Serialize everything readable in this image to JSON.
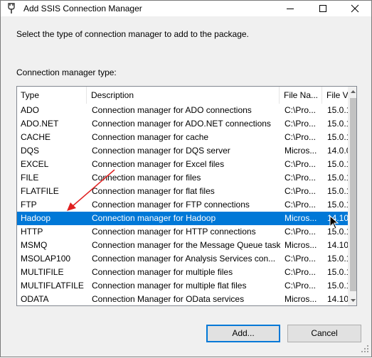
{
  "window": {
    "title": "Add SSIS Connection Manager",
    "controls": [
      "minimize-icon",
      "maximize-icon",
      "close-icon"
    ]
  },
  "dialog": {
    "instruction": "Select the type of connection manager to add to the package.",
    "list_label": "Connection manager type:"
  },
  "table": {
    "headers": {
      "type": "Type",
      "description": "Description",
      "file_name": "File Na...",
      "file_version": "File V"
    },
    "rows": [
      {
        "type": "ADO",
        "description": "Connection manager for ADO connections",
        "file_name": "C:\\Pro...",
        "file_version": "15.0.1"
      },
      {
        "type": "ADO.NET",
        "description": "Connection manager for ADO.NET connections",
        "file_name": "C:\\Pro...",
        "file_version": "15.0.1"
      },
      {
        "type": "CACHE",
        "description": "Connection manager for cache",
        "file_name": "C:\\Pro...",
        "file_version": "15.0.1"
      },
      {
        "type": "DQS",
        "description": "Connection manager for DQS server",
        "file_name": "Micros...",
        "file_version": "14.0.0"
      },
      {
        "type": "EXCEL",
        "description": "Connection manager for Excel files",
        "file_name": "C:\\Pro...",
        "file_version": "15.0.1"
      },
      {
        "type": "FILE",
        "description": "Connection manager for files",
        "file_name": "C:\\Pro...",
        "file_version": "15.0.1"
      },
      {
        "type": "FLATFILE",
        "description": "Connection manager for flat files",
        "file_name": "C:\\Pro...",
        "file_version": "15.0.1"
      },
      {
        "type": "FTP",
        "description": "Connection manager for FTP connections",
        "file_name": "C:\\Pro...",
        "file_version": "15.0.1"
      },
      {
        "type": "Hadoop",
        "description": "Connection manager for Hadoop",
        "file_name": "Micros...",
        "file_version": "14.10"
      },
      {
        "type": "HTTP",
        "description": "Connection manager for HTTP connections",
        "file_name": "C:\\Pro...",
        "file_version": "15.0.1"
      },
      {
        "type": "MSMQ",
        "description": "Connection manager for the Message Queue task",
        "file_name": "Micros...",
        "file_version": "14.10"
      },
      {
        "type": "MSOLAP100",
        "description": "Connection manager for Analysis Services con...",
        "file_name": "C:\\Pro...",
        "file_version": "15.0.1"
      },
      {
        "type": "MULTIFILE",
        "description": "Connection manager for multiple files",
        "file_name": "C:\\Pro...",
        "file_version": "15.0.1"
      },
      {
        "type": "MULTIFLATFILE",
        "description": "Connection manager for multiple flat files",
        "file_name": "C:\\Pro...",
        "file_version": "15.0.1"
      },
      {
        "type": "ODATA",
        "description": "Connection Manager for OData services",
        "file_name": "Micros...",
        "file_version": "14.10"
      }
    ],
    "selected_index": 8
  },
  "buttons": {
    "add": "Add...",
    "cancel": "Cancel"
  },
  "colors": {
    "selection": "#0078d7",
    "annotation_arrow": "#e02020"
  }
}
